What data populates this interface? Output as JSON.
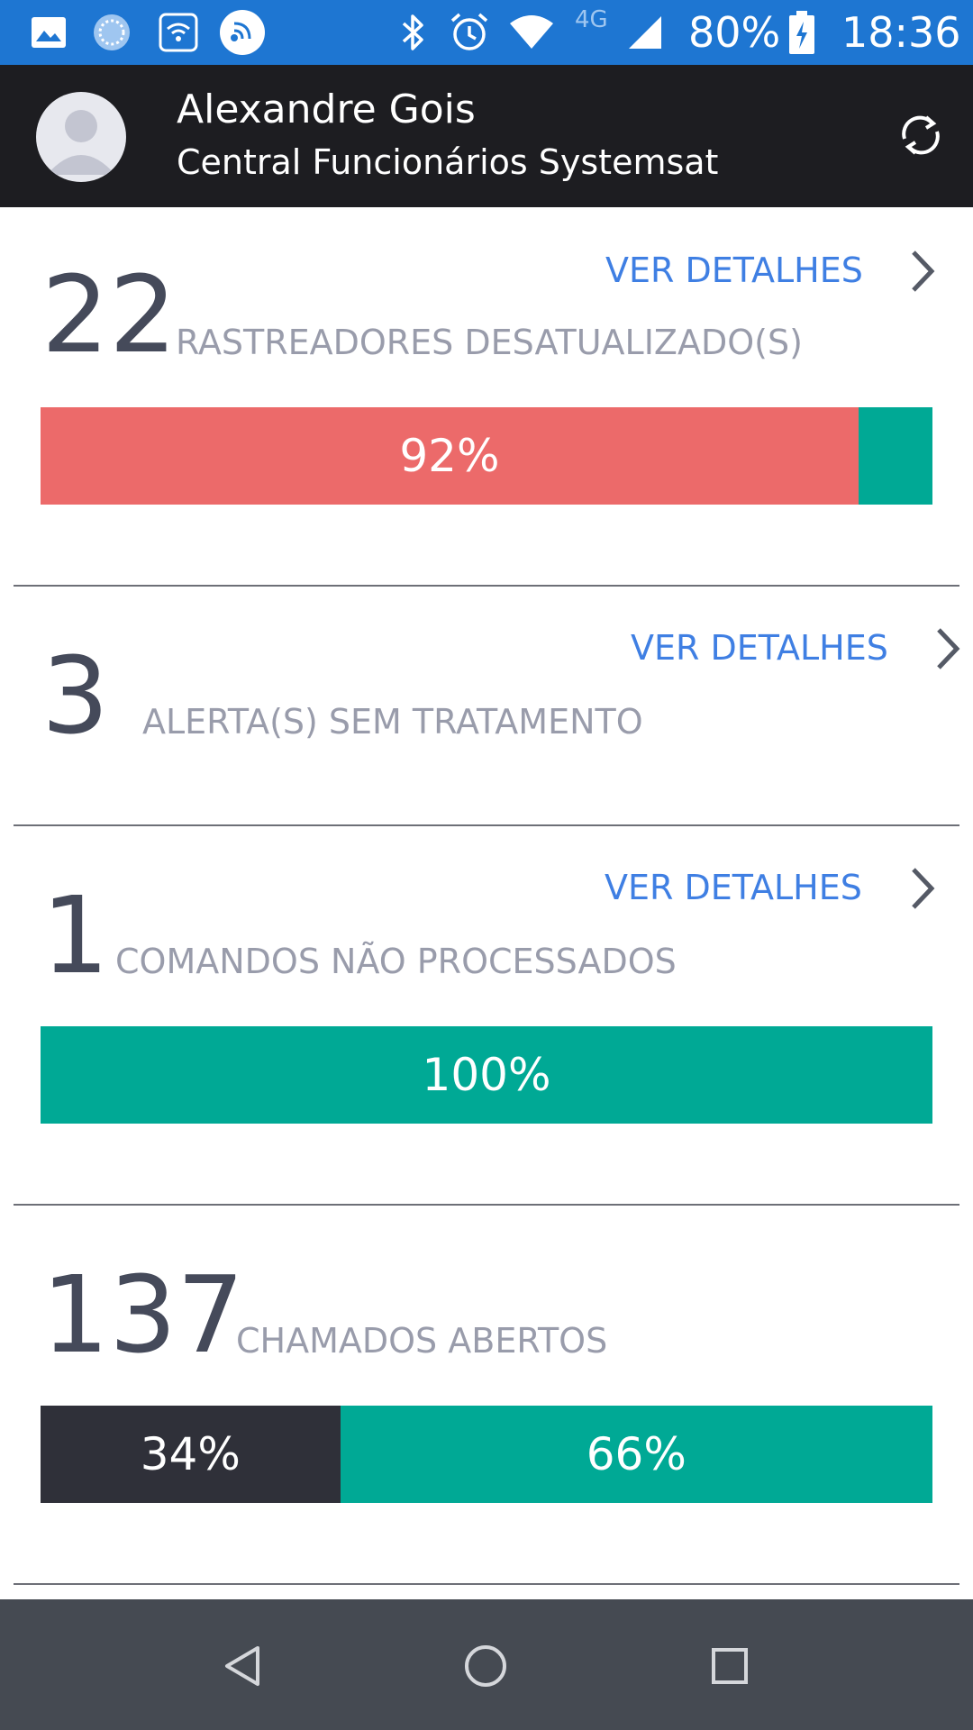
{
  "status_bar": {
    "battery": "80%",
    "time": "18:36",
    "network": "4G",
    "icons": [
      "gallery-icon",
      "sync-icon",
      "wifi-settings-icon",
      "signal-app-icon",
      "bluetooth-icon",
      "alarm-icon",
      "wifi-icon",
      "cellular-signal-icon",
      "battery-charging-icon"
    ]
  },
  "header": {
    "name": "Alexandre Gois",
    "subtitle": "Central Funcionários Systemsat",
    "refresh_icon": "refresh-icon"
  },
  "cards": [
    {
      "count": "22",
      "label": "RASTREADORES DESATUALIZADO(S)",
      "details": "VER DETALHES",
      "bar": [
        {
          "fraction": 0.917,
          "color": "#ec6a6a",
          "label": "92%"
        },
        {
          "fraction": 0.083,
          "color": "#00a995",
          "label": ""
        }
      ]
    },
    {
      "count": "3",
      "label": "ALERTA(S) SEM TRATAMENTO",
      "details": "VER DETALHES"
    },
    {
      "count": "1",
      "label": "COMANDOS NÃO PROCESSADOS",
      "details": "VER DETALHES",
      "bar": [
        {
          "fraction": 1.0,
          "color": "#00a995",
          "label": "100%"
        }
      ]
    },
    {
      "count": "137",
      "label": "CHAMADOS ABERTOS",
      "bar": [
        {
          "fraction": 0.336,
          "color": "#2f3039",
          "label": "34%"
        },
        {
          "fraction": 0.664,
          "color": "#00a995",
          "label": "66%"
        }
      ]
    }
  ],
  "nav_bar": {
    "back": "back-icon",
    "home": "home-icon",
    "recents": "recents-icon"
  }
}
